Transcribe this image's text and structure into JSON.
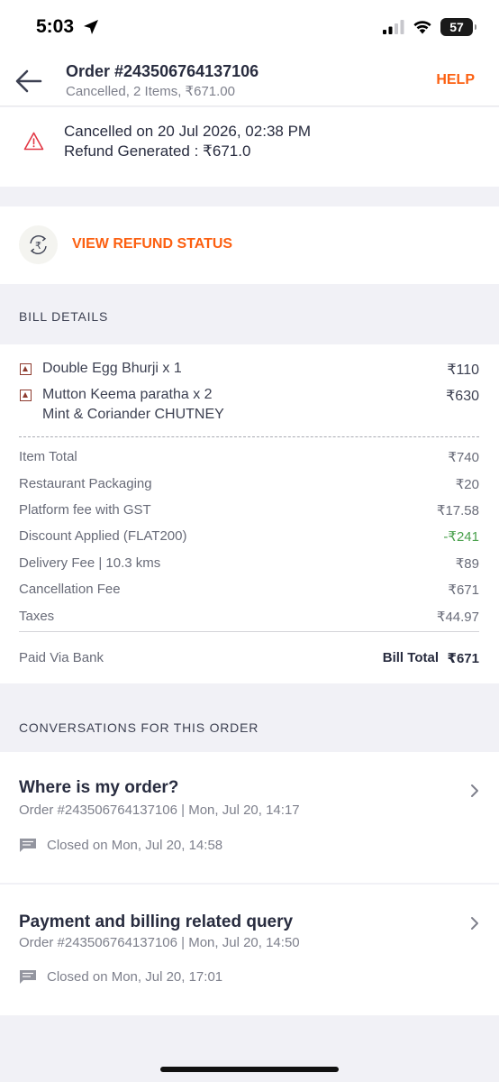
{
  "status_bar": {
    "time": "5:03",
    "battery": "57"
  },
  "header": {
    "title": "Order #243506764137106",
    "subtitle": "Cancelled, 2 Items, ₹671.00",
    "help_label": "HELP"
  },
  "cancellation": {
    "line1": "Cancelled on 20 Jul 2026, 02:38 PM",
    "line2": "Refund Generated : ₹671.0"
  },
  "refund": {
    "link_label": "VIEW REFUND STATUS"
  },
  "bill": {
    "heading": "BILL DETAILS",
    "items": [
      {
        "name": "Double Egg Bhurji x 1",
        "price": "₹110"
      },
      {
        "name": "Mutton Keema paratha x 2",
        "addon": "Mint & Coriander CHUTNEY",
        "price": "₹630"
      }
    ],
    "rows": [
      {
        "label": "Item Total",
        "value": "₹740"
      },
      {
        "label": "Restaurant Packaging",
        "value": "₹20"
      },
      {
        "label": "Platform fee with GST",
        "value": "₹17.58"
      },
      {
        "label": "Discount Applied (FLAT200)",
        "value": "-₹241"
      },
      {
        "label": "Delivery Fee | 10.3 kms",
        "value": "₹89"
      },
      {
        "label": "Cancellation Fee",
        "value": "₹671"
      },
      {
        "label": "Taxes",
        "value": "₹44.97"
      }
    ],
    "paid_via": "Paid Via Bank",
    "total_label": "Bill Total",
    "total_value": "₹671"
  },
  "conversations": {
    "heading": "CONVERSATIONS FOR THIS ORDER",
    "items": [
      {
        "title": "Where is my order?",
        "meta": "Order #243506764137106 | Mon, Jul 20, 14:17",
        "closed": "Closed on Mon, Jul 20, 14:58"
      },
      {
        "title": "Payment and billing related query",
        "meta": "Order #243506764137106 | Mon, Jul 20, 14:50",
        "closed": "Closed on Mon, Jul 20, 17:01"
      }
    ]
  },
  "colors": {
    "accent": "#fc6011",
    "discount_green": "#48a04b",
    "warning_red": "#e23744"
  }
}
